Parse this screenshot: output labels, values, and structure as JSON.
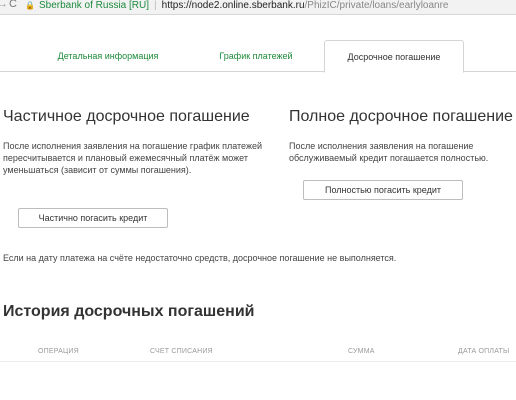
{
  "browser": {
    "forward_glyph": "→",
    "reload_glyph": "C",
    "site_name": "Sberbank of Russia [RU]",
    "separator": "|",
    "url_host": "https://node2.online.sberbank.ru",
    "url_path": "/PhizIC/private/loans/earlyloanre",
    "icons": [
      "forward-arrow-icon",
      "reload-icon",
      "lock-icon"
    ]
  },
  "tabs": [
    {
      "label": "Детальная информация",
      "active": false
    },
    {
      "label": "График платежей",
      "active": false
    },
    {
      "label": "Досрочное погашение",
      "active": true
    }
  ],
  "partial": {
    "title": "Частичное досрочное погашение",
    "description": "После исполнения заявления на погашение график платежей пересчитывается и плановый ежемесячный платёж может уменьшаться (зависит от суммы погашения).",
    "button": "Частично погасить кредит"
  },
  "full": {
    "title": "Полное досрочное погашение",
    "description": "После исполнения заявления на погашение обслуживаемый кредит погашается полностью.",
    "button": "Полностью погасить кредит"
  },
  "note": "Если на дату платежа на счёте недостаточно средств, досрочное погашение не выполняется.",
  "history": {
    "title": "История досрочных погашений",
    "columns": [
      "ОПЕРАЦИЯ",
      "СЧЕТ СПИСАНИЯ",
      "СУММА",
      "ДАТА ОПЛАТЫ"
    ]
  },
  "colors": {
    "brand_green": "#1e8a3a",
    "text": "#333333",
    "muted": "#999999"
  }
}
